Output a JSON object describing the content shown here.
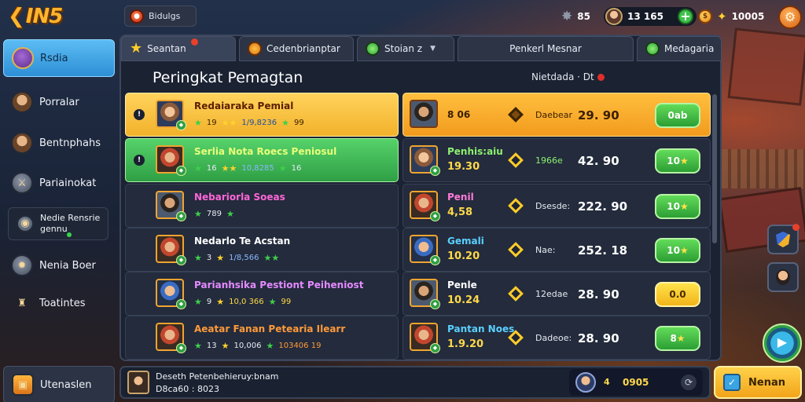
{
  "topbar": {
    "logo": "IN5",
    "player_name": "Bidulgs",
    "star_count": "85",
    "gems": "13 165",
    "coins": "10005"
  },
  "sidebar": {
    "items": [
      {
        "label": "Rsdia"
      },
      {
        "label": "Porralar"
      },
      {
        "label": "Bentnphahs"
      },
      {
        "label": "Pariainokat"
      },
      {
        "label": "Nedie Rensrie gennu"
      },
      {
        "label": "Nenia Boer"
      },
      {
        "label": "Toatintes"
      }
    ],
    "bottom_label": "Utenaslen"
  },
  "tabs": [
    {
      "label": "Seantan"
    },
    {
      "label": "Cedenbrianptar"
    },
    {
      "label": "Stoian z"
    },
    {
      "label": "Penkerl Mesnar"
    },
    {
      "label": "Medagaria"
    }
  ],
  "panel": {
    "title": "Peringkat Pemagtan",
    "subtitle": "Nietdada · Dt"
  },
  "left_rows": [
    {
      "name": "Redaiaraka Pemial",
      "stat1": "19",
      "stat2": "1/9,8236",
      "stat3": "99"
    },
    {
      "name": "Serlia Nota Roecs Peniosul",
      "stat1": "16",
      "stat2": "10,8285",
      "stat3": "16"
    },
    {
      "name": "Nebariorla Soeas",
      "stat1": "789",
      "stat2": "",
      "stat3": ""
    },
    {
      "name": "Nedarlo Te Acstan",
      "stat1": "3",
      "stat2": "1/8,566",
      "stat3": ""
    },
    {
      "name": "Parianhsika Pestiont Peiheniost",
      "stat1": "9",
      "stat2": "10,0 366",
      "stat3": "99"
    },
    {
      "name": "Aeatar Fanan Petearia Ilearr",
      "stat1": "13",
      "stat2": "10,006",
      "stat3": "103406 19"
    }
  ],
  "right_rows": [
    {
      "name": "8 06",
      "value": "",
      "label": "Daebear",
      "score": "29. 90",
      "button": "0ab"
    },
    {
      "name": "Penhis:aiu",
      "value": "19.30",
      "label": "1966e",
      "score": "42. 90",
      "button": "10"
    },
    {
      "name": "Penil",
      "value": "4,58",
      "label": "Dsesde:",
      "score": "222. 90",
      "button": "10"
    },
    {
      "name": "Gemali",
      "value": "10.20",
      "label": "Nae:",
      "score": "252. 18",
      "button": "10"
    },
    {
      "name": "Penle",
      "value": "10.24",
      "label": "12edae",
      "score": "28. 90",
      "button": "0.0"
    },
    {
      "name": "Pantan Noes",
      "value": "1.9.20",
      "label": "Dadeoe:",
      "score": "28. 90",
      "button": "8"
    }
  ],
  "bottom_bar": {
    "line1": "Deseth Petenbehieruy:bnam",
    "line2": "D8ca60 : 8023",
    "rank": "4",
    "score": "0905"
  },
  "action_button": "Nenan"
}
